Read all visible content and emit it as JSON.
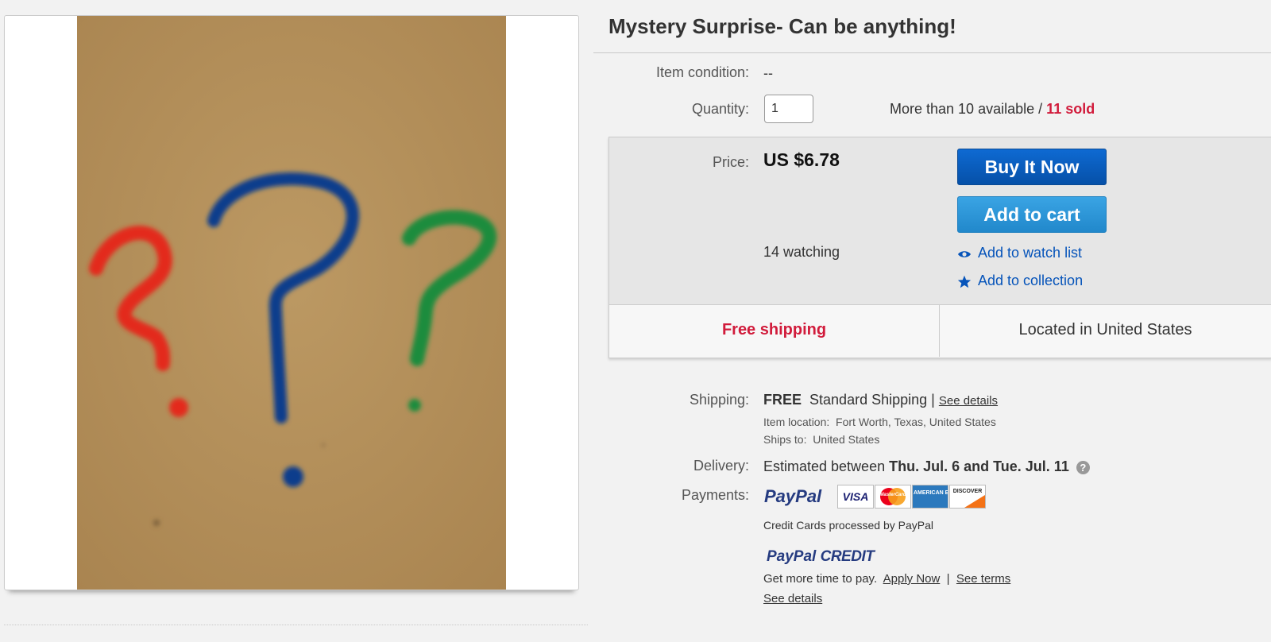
{
  "item": {
    "title": "Mystery Surprise- Can be anything!",
    "condition_label": "Item condition:",
    "condition_value": "--",
    "quantity_label": "Quantity:",
    "quantity_value": "1",
    "availability": "More than 10 available",
    "availability_sep": "/",
    "sold": "11 sold"
  },
  "buy_box": {
    "price_label": "Price:",
    "price": "US $6.78",
    "buy_now": "Buy It Now",
    "add_to_cart": "Add to cart",
    "watching": "14 watching",
    "watch_list": "Add to watch list",
    "collection": "Add to collection",
    "free_shipping": "Free shipping",
    "located": "Located in United States"
  },
  "shipping": {
    "label": "Shipping:",
    "free": "FREE",
    "method": "Standard Shipping |",
    "see_details": "See details",
    "item_location_label": "Item location:",
    "item_location": "Fort Worth, Texas, United States",
    "ships_to_label": "Ships to:",
    "ships_to": "United States"
  },
  "delivery": {
    "label": "Delivery:",
    "prefix": "Estimated between",
    "range": "Thu. Jul. 6 and Tue. Jul. 11",
    "help_icon": "?"
  },
  "payments": {
    "label": "Payments:",
    "paypal": "PayPal",
    "cards": [
      "VISA",
      "MasterCard",
      "AMERICAN EXPRESS",
      "DISCOVER"
    ],
    "note": "Credit Cards processed by PayPal",
    "credit_logo_pay": "PayPal",
    "credit_logo_word": "CREDIT",
    "credit_text": "Get more time to pay.",
    "apply_now": "Apply Now",
    "sep": "|",
    "see_terms": "See terms",
    "see_details": "See details"
  },
  "icons": {
    "eye": "eye-icon",
    "star": "star-icon",
    "help": "help-icon"
  },
  "colors": {
    "sold_red": "#d11b3b",
    "link_blue": "#0654ba",
    "buy_blue": "#0654ba",
    "cart_blue": "#2b95d6",
    "photo_bg": "#b8935e",
    "mark_red": "#e32a1c",
    "mark_blue": "#0d3c8c",
    "mark_green": "#1d8c3c"
  }
}
